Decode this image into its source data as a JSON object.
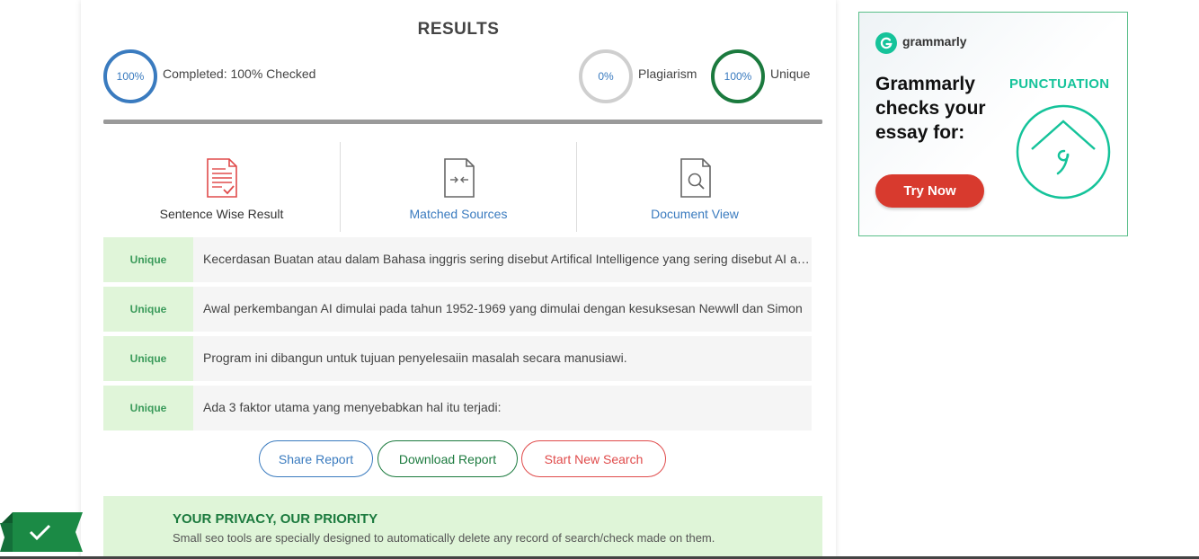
{
  "results": {
    "title": "RESULTS",
    "completed_percent": "100%",
    "completed_label": "Completed: 100% Checked",
    "plagiarism_percent": "0%",
    "plagiarism_label": "Plagiarism",
    "unique_percent": "100%",
    "unique_label": "Unique",
    "progress_fraction": 1.0
  },
  "tabs": [
    {
      "label": "Sentence Wise Result",
      "icon": "sentence-report-icon"
    },
    {
      "label": "Matched Sources",
      "icon": "matched-sources-icon"
    },
    {
      "label": "Document View",
      "icon": "document-search-icon"
    }
  ],
  "rows": [
    {
      "status": "Unique",
      "text": "Kecerdasan Buatan atau dalam Bahasa inggris sering disebut Artifical Intelligence yang sering disebut AI adalah"
    },
    {
      "status": "Unique",
      "text": "Awal perkembangan AI dimulai pada tahun 1952-1969 yang dimulai dengan kesuksesan Newwll dan Simon"
    },
    {
      "status": "Unique",
      "text": "Program ini dibangun untuk tujuan penyelesaiin masalah secara manusiawi."
    },
    {
      "status": "Unique",
      "text": "Ada 3 faktor utama yang menyebabkan hal itu terjadi:"
    }
  ],
  "actions": {
    "share": "Share Report",
    "download": "Download Report",
    "new_search": "Start New Search"
  },
  "privacy": {
    "title": "YOUR PRIVACY, OUR PRIORITY",
    "text": "Small seo tools are specially designed to automatically delete any record of search/check made on them."
  },
  "ad": {
    "brand": "grammarly",
    "headline": "Grammarly checks your essay for:",
    "feature": "PUNCTUATION",
    "cta": "Try Now"
  },
  "colors": {
    "blue": "#3a7bbf",
    "green": "#1b7a3e",
    "red": "#e04b4b",
    "grammarly_green": "#15c39a"
  }
}
